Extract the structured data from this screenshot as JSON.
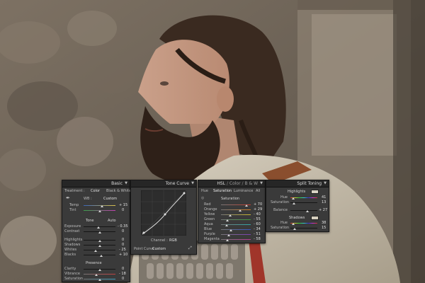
{
  "basic": {
    "title": "Basic",
    "treatment_label": "Treatment :",
    "color_label": "Color",
    "bw_label": "Black & White",
    "wb_label": "WB :",
    "wb_value": "Custom",
    "temp_label": "Temp",
    "temp_value": "+ 15",
    "tint_label": "Tint",
    "tint_value": "0",
    "tone_label": "Tone",
    "auto_label": "Auto",
    "exposure_label": "Exposure",
    "exposure_value": "- 0.35",
    "contrast_label": "Contrast",
    "contrast_value": "0",
    "highlights_label": "Highlights",
    "highlights_value": "0",
    "shadows_label": "Shadows",
    "shadows_value": "0",
    "whites_label": "Whites",
    "whites_value": "- 25",
    "blacks_label": "Blacks",
    "blacks_value": "+ 10",
    "presence_label": "Presence",
    "clarity_label": "Clarity",
    "clarity_value": "0",
    "vibrance_label": "Vibrance",
    "vibrance_value": "- 18",
    "saturation_label": "Saturation",
    "saturation_value": "0",
    "slider_levels": {
      "temp": 0.57,
      "tint": 0.5,
      "exposure": 0.46,
      "contrast": 0.5,
      "highlights": 0.5,
      "shadows": 0.5,
      "whites": 0.38,
      "blacks": 0.55,
      "clarity": 0.5,
      "vibrance": 0.41,
      "saturation": 0.5
    }
  },
  "tone_curve": {
    "title": "Tone Curve",
    "channel_label": "Channel :",
    "channel_value": "RGB",
    "point_curve_label": "Point Curve :",
    "point_curve_value": "Custom"
  },
  "hsl": {
    "title_hsl": "HSL",
    "title_sep1": "/",
    "title_color": "Color",
    "title_sep2": "/",
    "title_bw": "B & W",
    "tabs": [
      "Hue",
      "Saturation",
      "Luminance",
      "All"
    ],
    "section_label": "Saturation",
    "rows": [
      {
        "label": "Red",
        "value": "+ 70",
        "level": 0.85,
        "color": "#c0392b"
      },
      {
        "label": "Orange",
        "value": "+ 29",
        "level": 0.65,
        "color": "#d17a22"
      },
      {
        "label": "Yellow",
        "value": "- 40",
        "level": 0.3,
        "color": "#c9b52e"
      },
      {
        "label": "Green",
        "value": "- 55",
        "level": 0.22,
        "color": "#3b9a3b"
      },
      {
        "label": "Aqua",
        "value": "- 60",
        "level": 0.2,
        "color": "#2fa7a7"
      },
      {
        "label": "Blue",
        "value": "- 34",
        "level": 0.33,
        "color": "#3857c2"
      },
      {
        "label": "Purple",
        "value": "- 51",
        "level": 0.25,
        "color": "#7a3fb5"
      },
      {
        "label": "Magenta",
        "value": "- 58",
        "level": 0.21,
        "color": "#b83a95"
      }
    ]
  },
  "split_toning": {
    "title": "Split Toning",
    "highlights_label": "Highlights",
    "hue_label": "Hue",
    "hl_hue_value": "41",
    "saturation_label": "Saturation",
    "hl_sat_value": "13",
    "balance_label": "Balance",
    "balance_value": "+ 27",
    "shadows_label": "Shadows",
    "sh_hue_value": "38",
    "sh_sat_value": "15",
    "levels": {
      "hl_hue": 0.11,
      "hl_sat": 0.13,
      "balance": 0.64,
      "sh_hue": 0.11,
      "sh_sat": 0.15
    },
    "highlight_swatch": "#d9d3c4",
    "shadow_swatch": "#d6cfbf"
  },
  "colors": {
    "panel_bg": "#3a3a3a",
    "header_bg": "#262626"
  }
}
